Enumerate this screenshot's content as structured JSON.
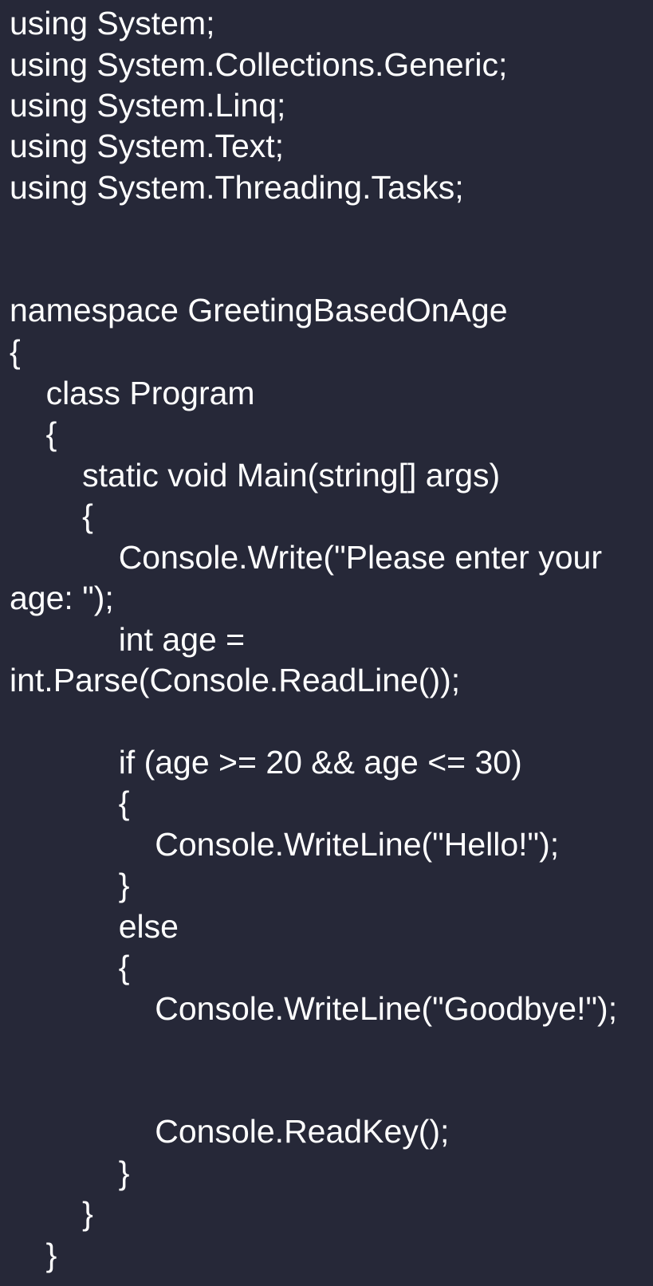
{
  "code": {
    "lines": [
      "using System;",
      "using System.Collections.Generic;",
      "using System.Linq;",
      "using System.Text;",
      "using System.Threading.Tasks;",
      "namespace GreetingBasedOnAge",
      "{",
      "    class Program",
      "    {",
      "        static void Main(string[] args)",
      "        {",
      "            Console.Write(\"Please enter your",
      "age: \");",
      "            int age =",
      "int.Parse(Console.ReadLine());",
      "            if (age >= 20 && age <= 30)",
      "            {",
      "                Console.WriteLine(\"Hello!\");",
      "            }",
      "            else",
      "            {",
      "                Console.WriteLine(\"Goodbye!\");",
      "                Console.ReadKey();",
      "            }",
      "        }",
      "    }"
    ]
  }
}
